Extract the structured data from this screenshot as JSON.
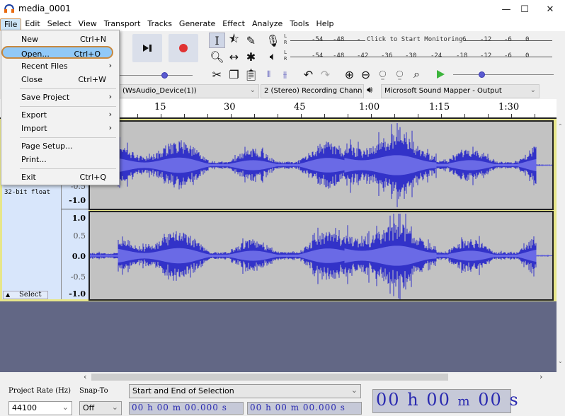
{
  "window": {
    "title": "media_0001",
    "controls": {
      "minimize": "—",
      "maximize": "☐",
      "close": "✕"
    }
  },
  "menubar": {
    "items": [
      "File",
      "Edit",
      "Select",
      "View",
      "Transport",
      "Tracks",
      "Generate",
      "Effect",
      "Analyze",
      "Tools",
      "Help"
    ],
    "active": "File"
  },
  "file_menu": {
    "items": [
      {
        "label": "New",
        "shortcut": "Ctrl+N"
      },
      {
        "label": "Open...",
        "shortcut": "Ctrl+O",
        "highlighted": true
      },
      {
        "label": "Recent Files",
        "submenu": "›"
      },
      {
        "label": "Close",
        "shortcut": "Ctrl+W"
      },
      {
        "label": "Save Project",
        "submenu": "›"
      },
      {
        "label": "Export",
        "submenu": "›"
      },
      {
        "label": "Import",
        "submenu": "›"
      },
      {
        "label": "Page Setup..."
      },
      {
        "label": "Print..."
      },
      {
        "label": "Exit",
        "shortcut": "Ctrl+Q"
      }
    ]
  },
  "transport": {
    "skip_end_icon": "skip-to-end",
    "record_icon": "record"
  },
  "tools": {
    "selection": "I",
    "envelope": "envelope",
    "draw": "pencil",
    "zoom": "magnifier",
    "timeshift": "↔",
    "multi": "✱"
  },
  "meters": {
    "record_ticks": [
      "-54",
      "-48",
      "-",
      "6",
      "-12",
      "-6",
      "0"
    ],
    "record_prompt": "Click to Start Monitoring",
    "playback_ticks": [
      "-54",
      "-48",
      "-42",
      "-36",
      "-30",
      "-24",
      "-18",
      "-12",
      "-6",
      "0"
    ],
    "channel_labels": [
      "L",
      "R"
    ]
  },
  "device_toolbar": {
    "recording_device": "(WsAudio_Device(1))",
    "recording_channels": "2 (Stereo) Recording Chann",
    "playback_device": "Microsoft Sound Mapper - Output"
  },
  "sliders": {
    "recording_volume": 0.62,
    "playback_speed": 0.28
  },
  "ruler": {
    "labels": [
      "15",
      "30",
      "45",
      "1:00",
      "1:15",
      "1:30"
    ]
  },
  "track": {
    "format": "32-bit float",
    "select_label": "Select",
    "collapse_icon": "▲",
    "scale_top": [
      "1.0",
      "0.5",
      "0.0",
      "-0.5",
      "-1.0"
    ],
    "scale_channel1_visible": [
      "-0.5",
      "-1.0"
    ]
  },
  "selection_toolbar": {
    "project_rate_label": "Project Rate (Hz)",
    "project_rate_value": "44100",
    "snap_to_label": "Snap-To",
    "snap_to_value": "Off",
    "selection_mode": "Start and End of Selection",
    "start_time": "00 h 00 m 00.000 s",
    "end_time": "00 h 00 m 00.000 s"
  },
  "audio_position": {
    "hours": "00",
    "h": "h",
    "minutes": "00",
    "m": "m",
    "seconds": "00",
    "s": "s"
  },
  "colors": {
    "waveform": "#3232c8",
    "waveform_bg": "#c2c2c2",
    "track_info_bg": "#d8e6fb",
    "empty_area": "#626785",
    "menu_highlight": "#91c9f7",
    "record_red": "#e03232",
    "play_green": "#3cb43c"
  }
}
